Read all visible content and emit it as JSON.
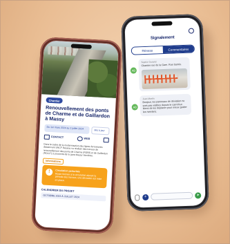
{
  "left_phone": {
    "tag": "Chantier",
    "title": "Renouvellement des ponts de Charme et de Gaillardon à Massy",
    "dates": {
      "main": "Du 1er mars 2024 au 2 juillet 2024",
      "side": "Mis à jour"
    },
    "actions": {
      "contact": "CONTACT",
      "web": "WEB"
    },
    "body": "Dans le cadre de la modernisation des lignes ferroviaires desservant SNCF Réseau va réaliser des travaux de renouvellement des ponts de Charme (RD59) et de Gaillardon (RD117) à proximité de la gare Massy Verrières.",
    "warning": {
      "tag": "Informations",
      "heading": "Circulation perturbée",
      "text": "Route fermée à la circulation durant la période des travaux, une déviation est mise en place."
    },
    "project_label": "CALENDRIER DU PROJET",
    "project_date": "OCTOBRE 2023 À JUILLET 2024"
  },
  "right_phone": {
    "brand": "Signalement",
    "tabs": [
      "Réseau",
      "Commentaires"
    ],
    "active_tab": 1,
    "messages": [
      {
        "avatar": "AB",
        "name": "Sophie Durand",
        "text": "Chantier rue de la Gare. Rue barrée.",
        "has_image": true
      },
      {
        "avatar": "AB",
        "name": "Jean Martin",
        "text": "Bonjour, les panneaux de déviation ne sont pas visibles depuis le carrefour. Merci de les déplacer pour mieux guider les riverains."
      }
    ]
  },
  "colors": {
    "navy": "#17266a",
    "orange": "#f7a21b",
    "green": "#64b85a",
    "background": "#e9bd93"
  }
}
